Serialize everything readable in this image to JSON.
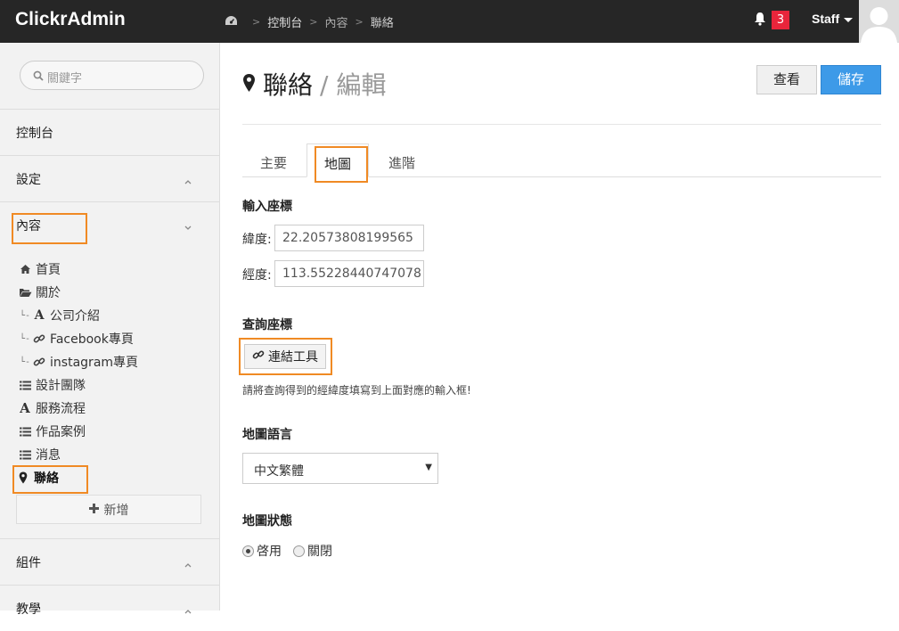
{
  "brand": "ClickrAdmin",
  "breadcrumb": [
    "控制台",
    "內容",
    "聯絡"
  ],
  "notifications": {
    "count": "3"
  },
  "user": {
    "name": "Staff"
  },
  "sidebar": {
    "search_placeholder": "關鍵字",
    "sections": {
      "dashboard": "控制台",
      "settings": "設定",
      "content": "內容",
      "components": "組件",
      "tutorial": "教學"
    },
    "tree": [
      {
        "label": "首頁",
        "icon": "home-icon"
      },
      {
        "label": "關於",
        "icon": "folder-open-icon"
      },
      {
        "label": "公司介紹",
        "icon": "font-icon"
      },
      {
        "label": "Facebook專頁",
        "icon": "link-icon"
      },
      {
        "label": "instagram專頁",
        "icon": "link-icon"
      },
      {
        "label": "設計團隊",
        "icon": "list-icon"
      },
      {
        "label": "服務流程",
        "icon": "font-icon"
      },
      {
        "label": "作品案例",
        "icon": "list-icon"
      },
      {
        "label": "消息",
        "icon": "list-icon"
      },
      {
        "label": "聯絡",
        "icon": "map-marker-icon"
      }
    ],
    "add_label": "新增"
  },
  "page": {
    "title": "聯絡",
    "subtitle": "/ 編輯",
    "view_label": "查看",
    "save_label": "儲存"
  },
  "tabs": [
    "主要",
    "地圖",
    "進階"
  ],
  "form": {
    "coords_heading": "輸入座標",
    "lat_label": "緯度:",
    "lat_value": "22.20573808199565",
    "lng_label": "經度:",
    "lng_value": "113.55228440747078",
    "lookup_heading": "查詢座標",
    "tool_label": "連結工具",
    "hint": "請將查詢得到的經緯度填寫到上面對應的輸入框!",
    "lang_heading": "地圖語言",
    "lang_value": "中文繁體",
    "status_heading": "地圖狀態",
    "status_on": "啓用",
    "status_off": "關閉"
  }
}
